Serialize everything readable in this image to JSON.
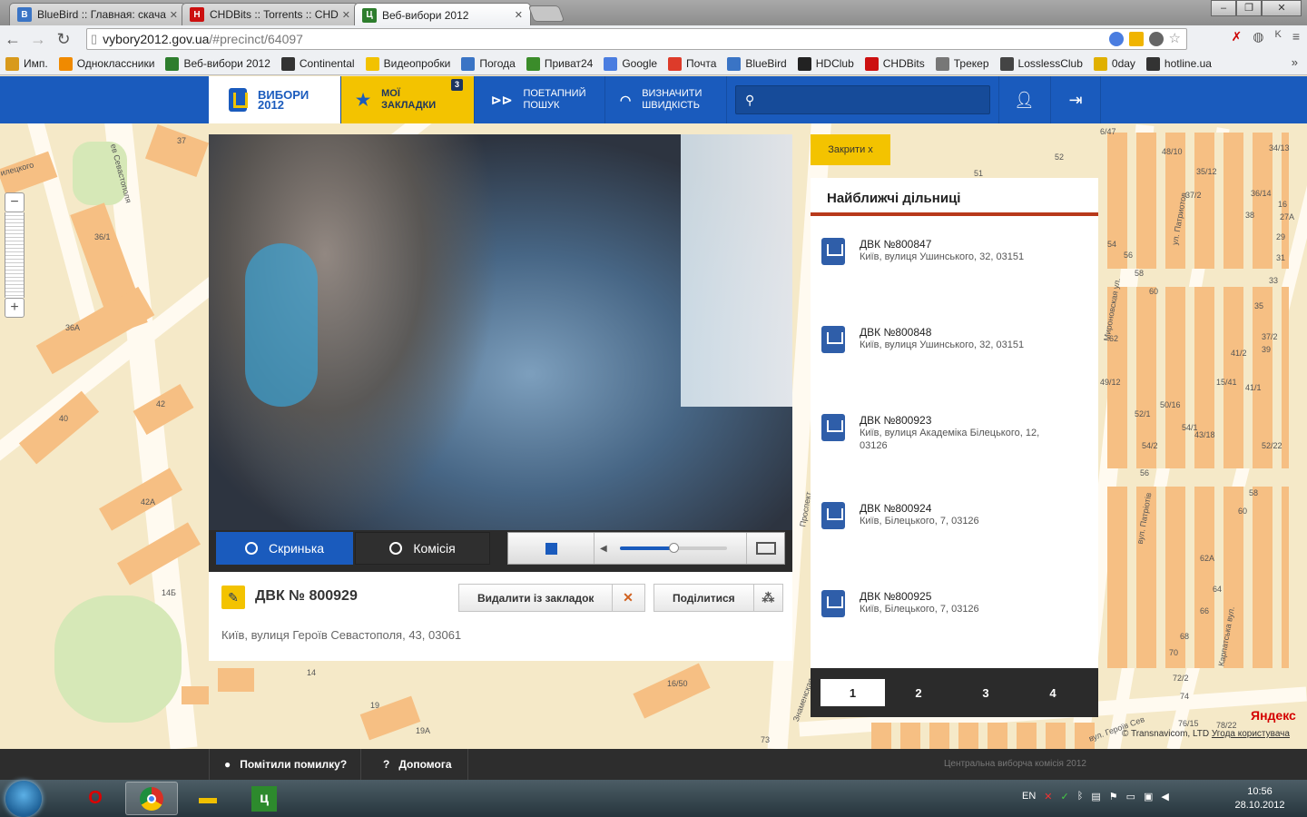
{
  "browser": {
    "tabs": [
      {
        "label": "BlueBird :: Главная: скачат",
        "icon_color": "#3a74c5",
        "icon_text": "B"
      },
      {
        "label": "CHDBits :: Torrents :: CHD",
        "icon_color": "#cc1010",
        "icon_text": "H"
      },
      {
        "label": "Веб-вибори 2012",
        "icon_color": "#2d7d2d",
        "icon_text": "Ц"
      }
    ],
    "url_host": "vybory2012.gov.ua",
    "url_path": "/#precinct/64097",
    "bookmarks": [
      {
        "label": "Имп.",
        "icon_color": "#d89a1c"
      },
      {
        "label": "Одноклассники",
        "icon_color": "#f08a00"
      },
      {
        "label": "Веб-вибори 2012",
        "icon_color": "#2d7d2d"
      },
      {
        "label": "Continental",
        "icon_color": "#333333"
      },
      {
        "label": "Видеопробки",
        "icon_color": "#f2c200"
      },
      {
        "label": "Погода",
        "icon_color": "#3a74c5"
      },
      {
        "label": "Приват24",
        "icon_color": "#3b8c2a"
      },
      {
        "label": "Google",
        "icon_color": "#4a7de0"
      },
      {
        "label": "Почта",
        "icon_color": "#dd3b2a"
      },
      {
        "label": "BlueBird",
        "icon_color": "#3a74c5"
      },
      {
        "label": "HDClub",
        "icon_color": "#222222"
      },
      {
        "label": "CHDBits",
        "icon_color": "#cc1010"
      },
      {
        "label": "Трекер",
        "icon_color": "#777777"
      },
      {
        "label": "LosslessClub",
        "icon_color": "#444444"
      },
      {
        "label": "0day",
        "icon_color": "#e0b000"
      },
      {
        "label": "hotline.ua",
        "icon_color": "#333333"
      }
    ],
    "more": "»"
  },
  "site": {
    "logo_line1": "ВИБОРИ",
    "logo_line2": "2012",
    "my_bookmarks_line1": "МОЇ",
    "my_bookmarks_line2": "ЗАКЛАДКИ",
    "bookmarks_count": "3",
    "step_search_line1": "ПОЕТАПНИЙ",
    "step_search_line2": "ПОШУК",
    "speed_line1": "ВИЗНАЧИТИ",
    "speed_line2": "ШВИДКІСТЬ",
    "search_placeholder": ""
  },
  "map": {
    "labels": [
      "37",
      "36/1",
      "36А",
      "42",
      "40",
      "42А",
      "14Б",
      "14",
      "19",
      "19А",
      "16/50",
      "73",
      "51",
      "52",
      "54",
      "56",
      "58",
      "60",
      "62",
      "6/47",
      "48/10",
      "35/12",
      "37/2",
      "34/13",
      "36/14",
      "38",
      "16",
      "27А",
      "29",
      "31",
      "33",
      "35",
      "37/2",
      "39",
      "41/2",
      "15/41",
      "41/1",
      "49/12",
      "52/1",
      "50/16",
      "54/1",
      "43/18",
      "54/2",
      "52/22",
      "56",
      "58",
      "60",
      "62А",
      "64",
      "66",
      "68",
      "70",
      "72/2",
      "74",
      "76/15",
      "78/22",
      "Проспект",
      "ул. Патриотов",
      "вул. Патріотів",
      "Мироновская ул.",
      "Карпатська вул.",
      "Знаменская",
      "вул. Героїв Сев"
    ],
    "street_left": "ев Севастополя",
    "street_left2": "илецкого",
    "yandex": "Яндекс",
    "copyright": "© Transnavicom, LTD",
    "terms": "Угода користувача"
  },
  "video": {
    "tab_box": "Скринька",
    "tab_commission": "Комісія",
    "volume_level": 0.5
  },
  "precinct": {
    "title": "ДВК № 800929",
    "address": "Київ, вулиця Героїв Севастополя, 43, 03061",
    "remove_label": "Видалити із закладок",
    "share_label": "Поділитися"
  },
  "panel": {
    "close_label": "Закрити  x",
    "title": "Найближчі дільниці",
    "items": [
      {
        "name": "ДВК №800847",
        "address": "Київ, вулиця Ушинського, 32, 03151"
      },
      {
        "name": "ДВК №800848",
        "address": "Київ, вулиця Ушинського, 32, 03151"
      },
      {
        "name": "ДВК №800923",
        "address": "Київ, вулиця Академіка Білецького, 12, 03126"
      },
      {
        "name": "ДВК №800924",
        "address": "Київ, Білецького, 7, 03126"
      },
      {
        "name": "ДВК №800925",
        "address": "Київ, Білецького, 7, 03126"
      }
    ],
    "pages": [
      "1",
      "2",
      "3",
      "4"
    ],
    "active_page": "1"
  },
  "footer": {
    "report_label": "Помітили помилку?",
    "help_label": "Допомога",
    "copyright": "Центральна виборча комісія 2012"
  },
  "taskbar": {
    "lang": "EN",
    "time": "10:56",
    "date": "28.10.2012"
  }
}
